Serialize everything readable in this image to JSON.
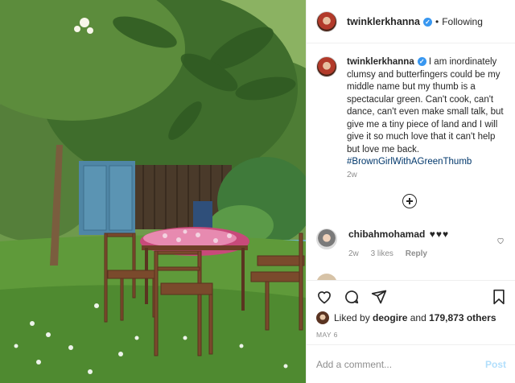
{
  "post_author": {
    "username": "twinklerkhanna",
    "verified_mark": "✓",
    "follow_state": "Following",
    "separator": "•"
  },
  "caption": {
    "username": "twinklerkhanna",
    "text": "I am inordinately clumsy and butterfingers could be my middle name but my thumb is a spectacular green. Can't cook, can't dance, can't even make small talk, but give me a tiny piece of land and I will give it so much love that it can't help but love me back.",
    "hashtag": "#BrownGirlWithAGreenThumb",
    "time": "2w"
  },
  "comments": [
    {
      "username": "chibahmohamad",
      "text": "♥♥♥",
      "time": "2w",
      "likes": "3 likes",
      "reply_label": "Reply"
    }
  ],
  "actions": {
    "icons": [
      "heart-icon",
      "comment-icon",
      "share-icon",
      "bookmark-icon"
    ],
    "liked_by_prefix": "Liked by",
    "liked_by_user": "deogire",
    "liked_by_and": "and",
    "liked_by_count": "179,873 others",
    "date": "MAY 6"
  },
  "add_comment": {
    "placeholder": "Add a comment...",
    "post_label": "Post"
  },
  "colors": {
    "link": "#00376b",
    "accent_blue": "#3897f0",
    "post_disabled": "#b2dffc",
    "muted": "#8e8e8e"
  }
}
